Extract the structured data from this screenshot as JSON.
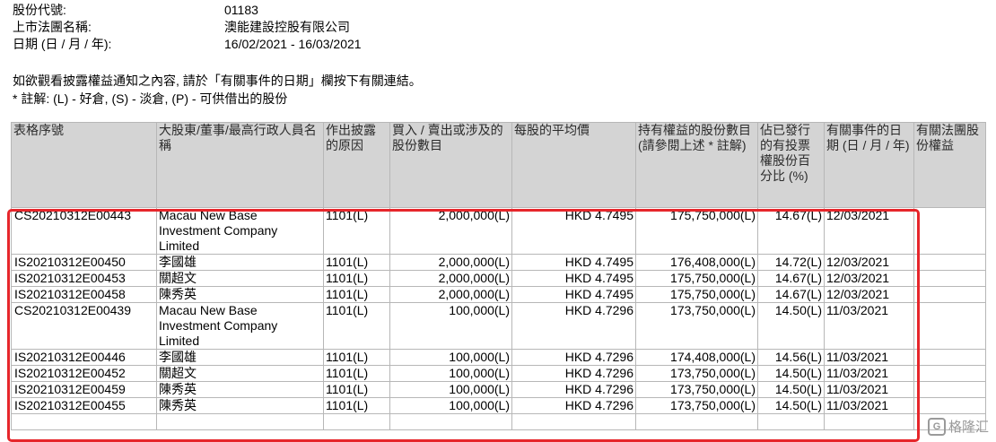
{
  "meta": {
    "stock_code_label": "股份代號:",
    "stock_code": "01183",
    "company_label": "上市法團名稱:",
    "company": "澳能建設控股有限公司",
    "date_label": "日期 (日 / 月 / 年):",
    "date_range": "16/02/2021 - 16/03/2021"
  },
  "notice": {
    "line1": "如欲觀看披露權益通知之內容, 請於「有關事件的日期」欄按下有關連結。",
    "line2": " * 註解: (L) - 好倉, (S) - 淡倉, (P) - 可供借出的股份"
  },
  "table": {
    "headers": [
      "表格序號",
      "大股東/董事/最高行政人員名稱",
      "作出披露的原因",
      "買入 / 賣出或涉及的股份數目",
      "每股的平均價",
      "持有權益的股份數目 (請參閱上述 * 註解)",
      "佔已發行的有投票權股份百分比 (%)",
      "有關事件的日期 (日 / 月 / 年)",
      "有關法團股份權益"
    ],
    "rows": [
      {
        "id": "CS20210312E00443",
        "name": "Macau New Base Investment Company Limited",
        "reason": "1101(L)",
        "shares": "2,000,000(L)",
        "price": "HKD 4.7495",
        "holding": "175,750,000(L)",
        "pct": "14.67(L)",
        "date": "12/03/2021",
        "related": ""
      },
      {
        "id": "IS20210312E00450",
        "name": "李國雄",
        "reason": "1101(L)",
        "shares": "2,000,000(L)",
        "price": "HKD 4.7495",
        "holding": "176,408,000(L)",
        "pct": "14.72(L)",
        "date": "12/03/2021",
        "related": ""
      },
      {
        "id": "IS20210312E00453",
        "name": "關超文",
        "reason": "1101(L)",
        "shares": "2,000,000(L)",
        "price": "HKD 4.7495",
        "holding": "175,750,000(L)",
        "pct": "14.67(L)",
        "date": "12/03/2021",
        "related": ""
      },
      {
        "id": "IS20210312E00458",
        "name": "陳秀英",
        "reason": "1101(L)",
        "shares": "2,000,000(L)",
        "price": "HKD 4.7495",
        "holding": "175,750,000(L)",
        "pct": "14.67(L)",
        "date": "12/03/2021",
        "related": ""
      },
      {
        "id": "CS20210312E00439",
        "name": "Macau New Base Investment Company Limited",
        "reason": "1101(L)",
        "shares": "100,000(L)",
        "price": "HKD 4.7296",
        "holding": "173,750,000(L)",
        "pct": "14.50(L)",
        "date": "11/03/2021",
        "related": ""
      },
      {
        "id": "IS20210312E00446",
        "name": "李國雄",
        "reason": "1101(L)",
        "shares": "100,000(L)",
        "price": "HKD 4.7296",
        "holding": "174,408,000(L)",
        "pct": "14.56(L)",
        "date": "11/03/2021",
        "related": ""
      },
      {
        "id": "IS20210312E00452",
        "name": "關超文",
        "reason": "1101(L)",
        "shares": "100,000(L)",
        "price": "HKD 4.7296",
        "holding": "173,750,000(L)",
        "pct": "14.50(L)",
        "date": "11/03/2021",
        "related": ""
      },
      {
        "id": "IS20210312E00459",
        "name": "陳秀英",
        "reason": "1101(L)",
        "shares": "100,000(L)",
        "price": "HKD 4.7296",
        "holding": "173,750,000(L)",
        "pct": "14.50(L)",
        "date": "11/03/2021",
        "related": ""
      },
      {
        "id": "IS20210312E00455",
        "name": "陳秀英",
        "reason": "1101(L)",
        "shares": "100,000(L)",
        "price": "HKD 4.7296",
        "holding": "173,750,000(L)",
        "pct": "14.50(L)",
        "date": "11/03/2021",
        "related": ""
      }
    ]
  },
  "highlight_color": "#e6262b",
  "header_bg": "#d4d4d4",
  "watermark": {
    "icon": "gelonghui-logo-icon",
    "logo_glyph": "G",
    "text": "格隆汇"
  }
}
